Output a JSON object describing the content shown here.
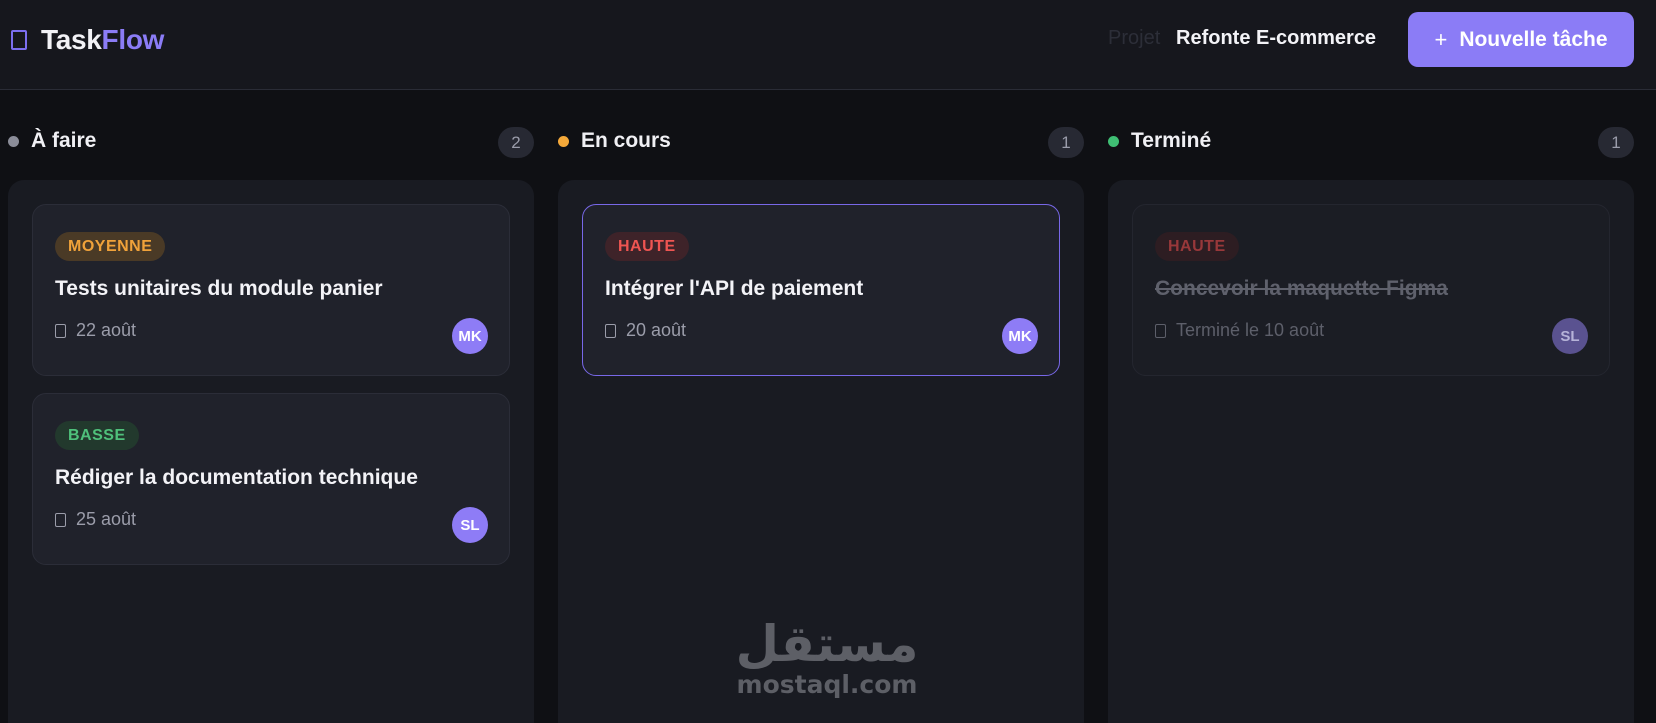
{
  "app": {
    "logo_part1": "Task",
    "logo_part2": "Flow",
    "project_label": "Projet",
    "project_name": "Refonte E-commerce",
    "new_task_label": "Nouvelle tâche",
    "new_task_icon": "+",
    "accent_color": "#8b7cf6"
  },
  "columns": [
    {
      "title": "À faire",
      "count": "2",
      "dot_color": "#8b8d99",
      "cards": [
        {
          "priority": "MOYENNE",
          "title": "Tests unitaires du module panier",
          "date": "22 août",
          "assignee": "MK"
        },
        {
          "priority": "BASSE",
          "title": "Rédiger la documentation technique",
          "date": "25 août",
          "assignee": "SL"
        }
      ]
    },
    {
      "title": "En cours",
      "count": "1",
      "dot_color": "#f5a93a",
      "cards": [
        {
          "priority": "HAUTE",
          "title": "Intégrer l'API de paiement",
          "date": "20 août",
          "assignee": "MK"
        }
      ]
    },
    {
      "title": "Terminé",
      "count": "1",
      "dot_color": "#3fbf74",
      "cards": [
        {
          "priority": "HAUTE",
          "title": "Concevoir la maquette Figma",
          "date": "Terminé le 10 août",
          "assignee": "SL"
        }
      ]
    }
  ],
  "watermark": {
    "arabic": "مستقل",
    "latin": "mostaql.com"
  }
}
